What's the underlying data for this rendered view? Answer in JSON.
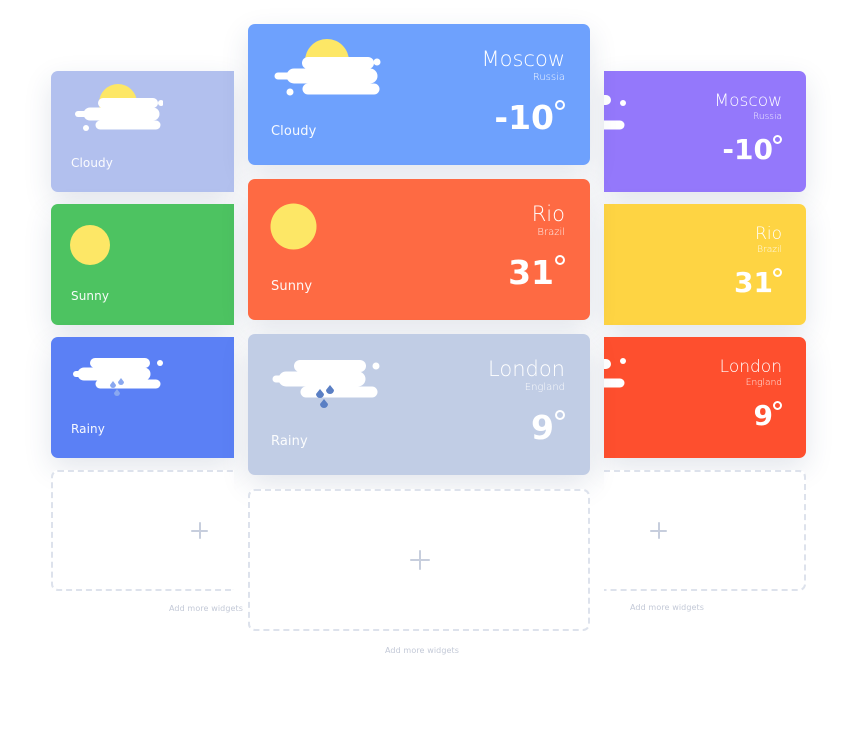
{
  "left": {
    "cards": [
      {
        "condition": "Cloudy",
        "color": "#b2c0ee",
        "icon": "sun-cloud-icon"
      },
      {
        "condition": "Sunny",
        "color": "#4dc361",
        "icon": "sun-icon"
      },
      {
        "condition": "Rainy",
        "color": "#5b80f5",
        "icon": "rain-cloud-icon"
      }
    ],
    "add_label": "Add more widgets"
  },
  "middle": {
    "cards": [
      {
        "condition": "Cloudy",
        "city": "Moscow",
        "country": "Russia",
        "temp": "-10",
        "color": "#6ea1fd",
        "icon": "sun-cloud-icon"
      },
      {
        "condition": "Sunny",
        "city": "Rio",
        "country": "Brazil",
        "temp": "31",
        "color": "#fe6a43",
        "icon": "sun-icon"
      },
      {
        "condition": "Rainy",
        "city": "London",
        "country": "England",
        "temp": "9",
        "color": "#c1cde5",
        "icon": "rain-cloud-icon"
      }
    ],
    "add_label": "Add more widgets"
  },
  "right": {
    "cards": [
      {
        "city": "Moscow",
        "country": "Russia",
        "temp": "-10",
        "color": "#9478fb"
      },
      {
        "city": "Rio",
        "country": "Brazil",
        "temp": "31",
        "color": "#fed443"
      },
      {
        "city": "London",
        "country": "England",
        "temp": "9",
        "color": "#fe4f2e"
      }
    ],
    "add_label": "Add more widgets"
  },
  "colors": {
    "sun": "#fde766",
    "cloud": "#ffffff",
    "rain_left": "#8aa8f0",
    "rain_mid": "#5a7fc4",
    "dashed_border": "#dde2ec",
    "plus": "#c7cedd"
  }
}
